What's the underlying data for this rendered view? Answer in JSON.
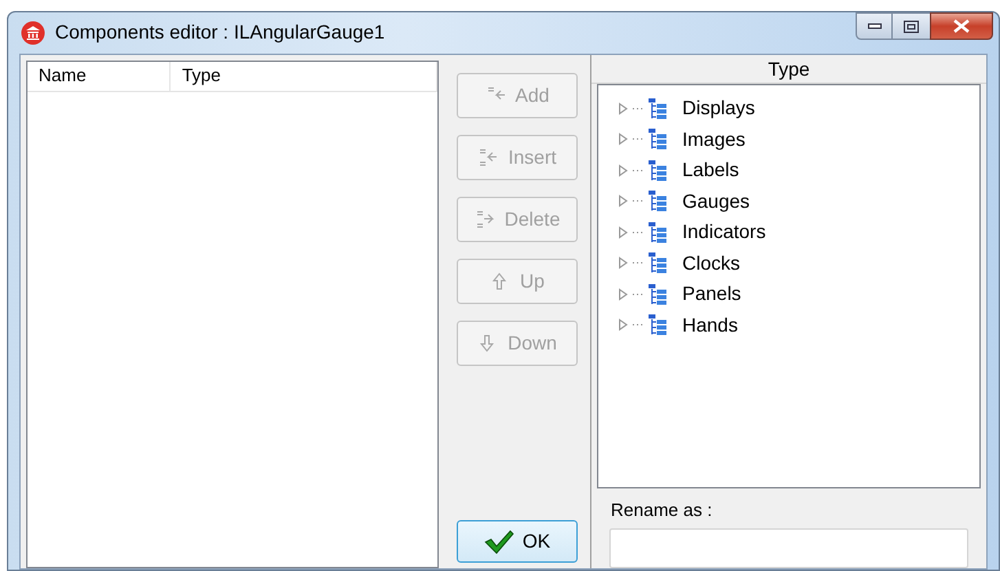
{
  "window": {
    "title": "Components editor : ILAngularGauge1"
  },
  "list": {
    "columns": [
      "Name",
      "Type"
    ]
  },
  "buttons": [
    {
      "label": "Add",
      "kind": "add",
      "disabled": true
    },
    {
      "label": "Insert",
      "kind": "insert",
      "disabled": true
    },
    {
      "label": "Delete",
      "kind": "delete",
      "disabled": true
    },
    {
      "label": "Up",
      "kind": "up",
      "disabled": true
    },
    {
      "label": "Down",
      "kind": "down",
      "disabled": true
    }
  ],
  "ok_button": {
    "label": "OK"
  },
  "type_panel": {
    "header": "Type",
    "items": [
      {
        "label": "Displays",
        "expanded": false
      },
      {
        "label": "Images",
        "expanded": false
      },
      {
        "label": "Labels",
        "expanded": false
      },
      {
        "label": "Gauges",
        "expanded": false
      },
      {
        "label": "Indicators",
        "expanded": false
      },
      {
        "label": "Clocks",
        "expanded": false
      },
      {
        "label": "Panels",
        "expanded": false
      },
      {
        "label": "Hands",
        "expanded": false
      }
    ]
  },
  "rename": {
    "label": "Rename as :"
  }
}
